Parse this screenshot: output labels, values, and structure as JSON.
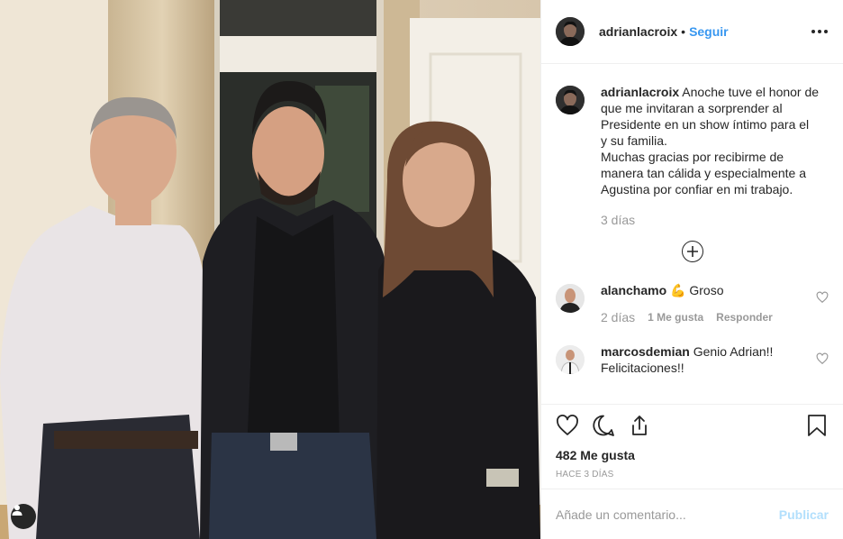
{
  "post": {
    "username": "adrianlacroix",
    "separator": "•",
    "follow_label": "Seguir",
    "more_icon": "more-options-icon",
    "caption": {
      "username": "adrianlacroix",
      "lines": [
        "Anoche tuve el honor de",
        "que me invitaran a sorprender al",
        "Presidente en un show íntimo para el",
        "y su familia.",
        "Muchas gracias por recibirme de",
        "manera tan cálida y especialmente a",
        "Agustina por confiar en mi trabajo."
      ],
      "time": "3 días"
    },
    "comments": [
      {
        "username": "alanchamo",
        "text": "💪 Groso",
        "time": "2 días",
        "likes": "1 Me gusta",
        "reply": "Responder"
      },
      {
        "username": "marcosdemian",
        "text": "Genio Adrian!!",
        "text2": "Felicitaciones!!"
      }
    ],
    "likes_count": "482 Me gusta",
    "posted_ago": "HACE 3 DÍAS",
    "comment_placeholder": "Añade un comentario...",
    "publish_label": "Publicar",
    "colors": {
      "link_blue": "#3897f0",
      "publish_disabled": "#b2dffc",
      "muted": "#999999"
    }
  }
}
